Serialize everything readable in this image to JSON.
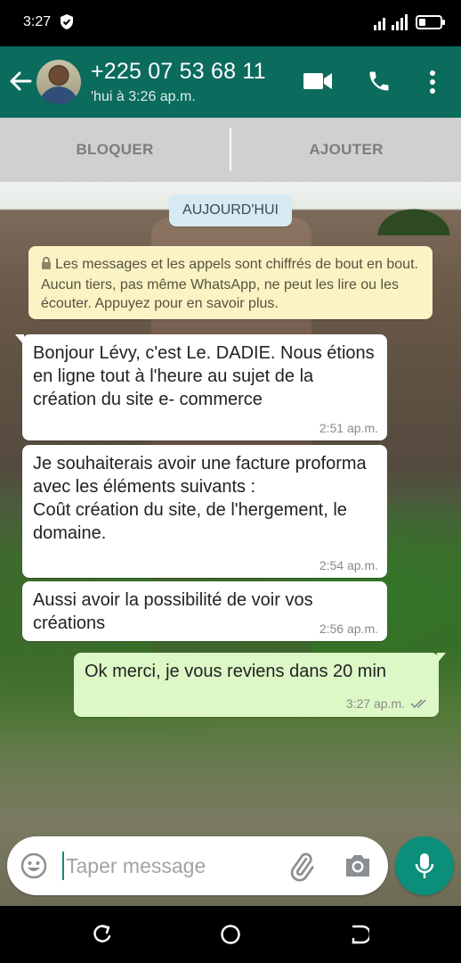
{
  "status_bar": {
    "time": "3:27",
    "icons": [
      "shield-icon",
      "signal-icon",
      "battery-icon"
    ]
  },
  "header": {
    "contact_name": "+225 07 53 68 11",
    "last_seen": "'hui à 3:26 ap.m.",
    "icons": [
      "back-arrow-icon",
      "video-call-icon",
      "phone-icon",
      "more-vert-icon"
    ]
  },
  "actions": {
    "block_label": "BLOQUER",
    "add_label": "AJOUTER"
  },
  "chat": {
    "date_label": "AUJOURD'HUI",
    "encryption_notice": "Les messages et les appels sont chiffrés de bout en bout. Aucun tiers, pas même WhatsApp, ne peut les lire ou les écouter. Appuyez pour en savoir plus.",
    "messages": [
      {
        "direction": "in",
        "text": "Bonjour Lévy, c'est Le. DADIE. Nous étions en ligne tout à l'heure au sujet de la création du site e- commerce",
        "time": "2:51 ap.m."
      },
      {
        "direction": "in",
        "text": "Je souhaiterais avoir une facture proforma avec les éléments suivants :\nCoût création du site, de l'hergement, le domaine.",
        "time": "2:54 ap.m."
      },
      {
        "direction": "in",
        "text": "Aussi avoir la possibilité de voir vos créations",
        "time": "2:56 ap.m."
      },
      {
        "direction": "out",
        "text": "Ok merci, je vous reviens dans 20 min",
        "time": "3:27 ap.m.",
        "status": "delivered"
      }
    ]
  },
  "composer": {
    "placeholder": "Taper message",
    "value": "",
    "icons": [
      "emoji-icon",
      "attach-icon",
      "camera-icon",
      "mic-icon"
    ]
  },
  "colors": {
    "header": "#0b6b5c",
    "accent": "#0b8f7a",
    "outgoing_bubble": "#dcf8c6",
    "incoming_bubble": "#ffffff",
    "notice_bg": "#fbf3c4"
  }
}
